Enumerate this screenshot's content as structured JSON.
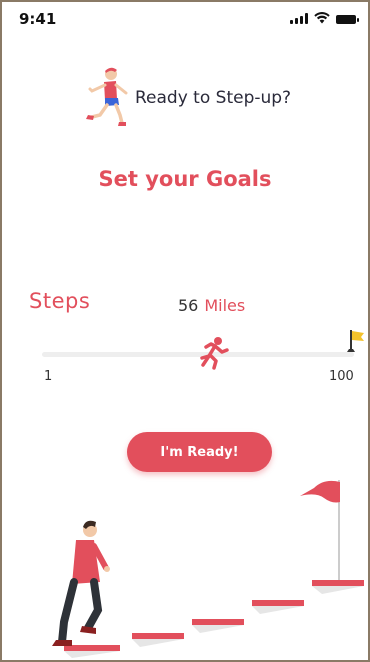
{
  "status_bar": {
    "time": "9:41"
  },
  "header": {
    "headline": "Ready to Step-up?",
    "title": "Set your Goals"
  },
  "goal": {
    "steps_label": "Steps",
    "value": "56",
    "unit": "Miles",
    "slider": {
      "min_label": "1",
      "max_label": "100",
      "fraction": 0.55
    }
  },
  "cta": {
    "label": "I'm Ready!"
  },
  "icons": {
    "runner": "runner-icon",
    "slider_thumb": "running-person-icon",
    "finish": "finish-flag-icon"
  },
  "colors": {
    "accent": "#e24f5c",
    "text_dark": "#2a2a3a",
    "track": "#eeeeee"
  }
}
